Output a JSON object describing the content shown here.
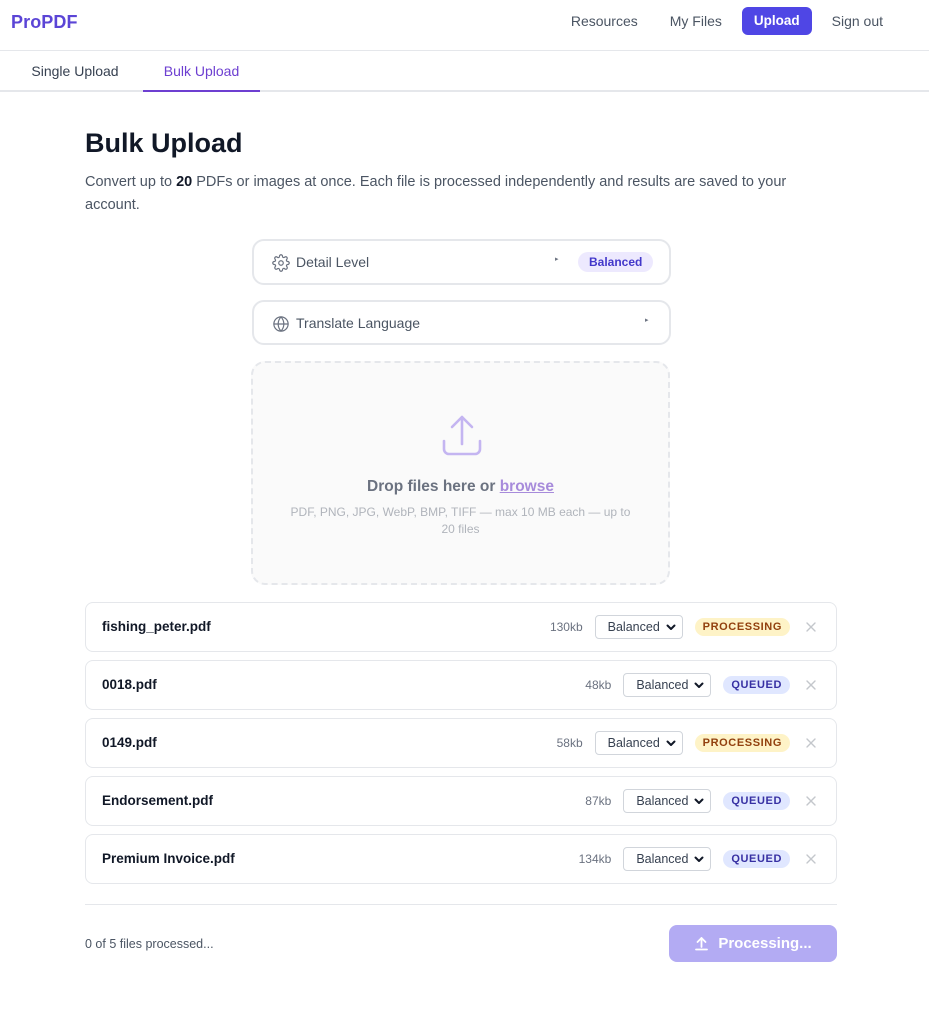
{
  "nav": {
    "logo": "ProPDF",
    "links": [
      "Resources",
      "My Files"
    ],
    "upload": "Upload",
    "signout": "Sign out"
  },
  "tabs": [
    "Single Upload",
    "Bulk Upload"
  ],
  "active_tab": "Bulk Upload",
  "page": {
    "title": "Bulk Upload",
    "subtitle_prefix": "Convert up to ",
    "max_files": "20",
    "subtitle_suffix": " PDFs or images at once. Each file is processed independently and results are saved to your account."
  },
  "options": {
    "detail_label": "Detail Level",
    "detail_value": "Balanced",
    "translate_label": "Translate Language",
    "caret": "▸"
  },
  "dropzone": {
    "text": "Drop files here or ",
    "link": "browse",
    "hint": "PDF, PNG, JPG, WebP, BMP, TIFF — max 10 MB each — up to 20 files"
  },
  "files": [
    {
      "name": "fishing_peter.pdf",
      "size": "130kb",
      "detail": "Balanced",
      "status": "PROCESSING"
    },
    {
      "name": "0018.pdf",
      "size": "48kb",
      "detail": "Balanced",
      "status": "QUEUED"
    },
    {
      "name": "0149.pdf",
      "size": "58kb",
      "detail": "Balanced",
      "status": "PROCESSING"
    },
    {
      "name": "Endorsement.pdf",
      "size": "87kb",
      "detail": "Balanced",
      "status": "QUEUED"
    },
    {
      "name": "Premium Invoice.pdf",
      "size": "134kb",
      "detail": "Balanced",
      "status": "QUEUED"
    }
  ],
  "footer": {
    "progress": "0 of 5 files processed...",
    "button": "Processing..."
  },
  "colors": {
    "brand": "#5b45d6",
    "primary_button": "#4f46e5",
    "active_tab": "#6d3fd1",
    "processing_bg": "#fef3c7",
    "queued_bg": "#e0e7ff",
    "disabled_button": "#b3abf3"
  },
  "icons": {
    "detail": "gear-icon",
    "translate": "globe-icon",
    "dropzone": "upload-icon",
    "file_select": "chevron-down-icon",
    "file_remove": "close-icon",
    "button": "upload-arrow-icon"
  }
}
